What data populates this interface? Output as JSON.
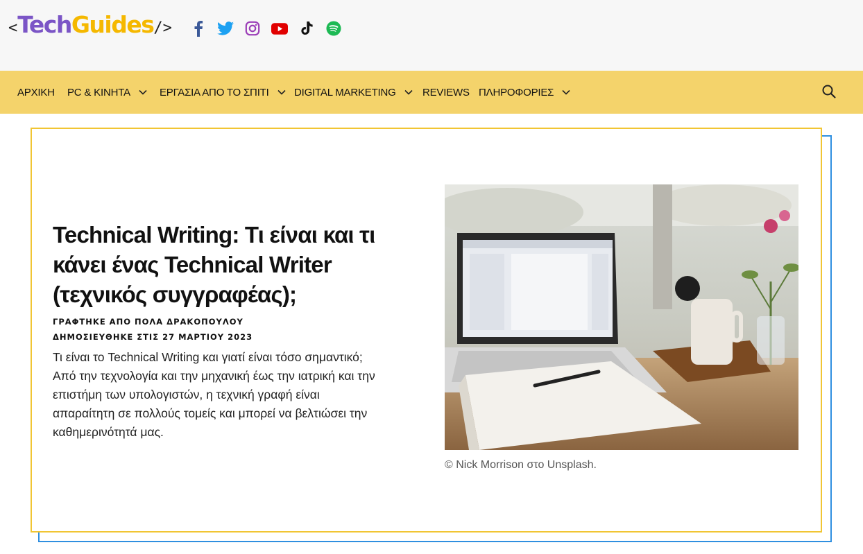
{
  "logo": {
    "open": "<",
    "tech": "Tech",
    "guides": "Guides",
    "close": "/>"
  },
  "social": [
    "facebook-icon",
    "twitter-icon",
    "instagram-icon",
    "youtube-icon",
    "tiktok-icon",
    "spotify-icon"
  ],
  "colors": {
    "nav_bg": "#f4d36b",
    "card_border": "#f1c533",
    "shadow_border": "#2f8fe0",
    "logo_purple": "#7b55c6",
    "logo_yellow": "#f5b800"
  },
  "nav": {
    "items": [
      {
        "label": "ΑΡΧΙΚΗ"
      },
      {
        "label": "PC & ΚΙΝΗΤΑ"
      },
      {
        "label": "ΕΡΓΑΣΙΑ ΑΠΟ ΤΟ ΣΠΙΤΙ"
      },
      {
        "label": "DIGITAL MARKETING"
      },
      {
        "label": "REVIEWS"
      },
      {
        "label": "ΠΛΗΡΟΦΟΡΙΕΣ"
      }
    ],
    "search_icon": "search-icon"
  },
  "article": {
    "title": "Technical Writing: Τι είναι και τι κάνει ένας Technical Writer (τεχνικός συγγραφέας);",
    "author_line": "ΓΡΑΦΤΗΚΕ ΑΠΟ ΠΟΛΑ ΔΡΑΚΟΠΟΥΛΟΥ",
    "date_line": "ΔΗΜΟΣΙΕΥΘΗΚΕ ΣΤΙΣ 27 ΜΑΡΤΙΟΥ 2023",
    "excerpt": "Τι είναι το Technical Writing και γιατί είναι τόσο σημαντικό; Από την τεχνολογία και την μηχανική έως την ιατρική και την επιστήμη των υπολογιστών, η τεχνική γραφή είναι απαραίτητη σε πολλούς τομείς και μπορεί να βελτιώσει την καθημερινότητά μας.",
    "image_caption": "© Nick Morrison στο Unsplash."
  }
}
